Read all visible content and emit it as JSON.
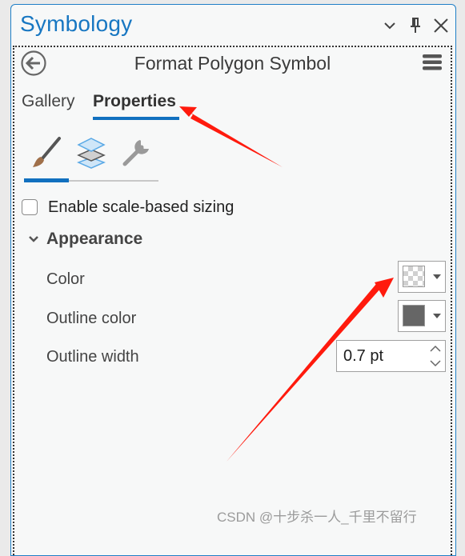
{
  "pane": {
    "title": "Symbology",
    "buttons": {
      "options_icon": "chevron-down-icon",
      "pin_icon": "pin-icon",
      "close_icon": "close-icon"
    }
  },
  "header": {
    "back_icon": "back-arrow-icon",
    "title": "Format Polygon Symbol",
    "menu_icon": "hamburger-menu-icon"
  },
  "tabs": [
    {
      "label": "Gallery",
      "active": false
    },
    {
      "label": "Properties",
      "active": true
    }
  ],
  "sub_tabs": [
    {
      "icon": "paintbrush-icon",
      "name": "symbol",
      "active": true
    },
    {
      "icon": "layers-icon",
      "name": "layers",
      "active": false
    },
    {
      "icon": "wrench-icon",
      "name": "structure",
      "active": false
    }
  ],
  "options": {
    "scale_sizing": {
      "label": "Enable scale-based sizing",
      "checked": false
    }
  },
  "appearance": {
    "title": "Appearance",
    "expanded": true,
    "properties": [
      {
        "label": "Color",
        "type": "color",
        "value": "no-color (transparent)"
      },
      {
        "label": "Outline color",
        "type": "color",
        "value": "#666666"
      },
      {
        "label": "Outline width",
        "type": "number",
        "value": "0.7 pt"
      }
    ]
  },
  "annotations": {
    "arrow_color": "#ff1a0d",
    "arrows": [
      {
        "points_to": "tab-properties"
      },
      {
        "points_to": "color-picker-button"
      }
    ]
  },
  "watermark": "CSDN @十步杀一人_千里不留行",
  "colors": {
    "accent": "#1877c2",
    "tab_indicator": "#1170bf",
    "background": "#f7f8f8"
  }
}
